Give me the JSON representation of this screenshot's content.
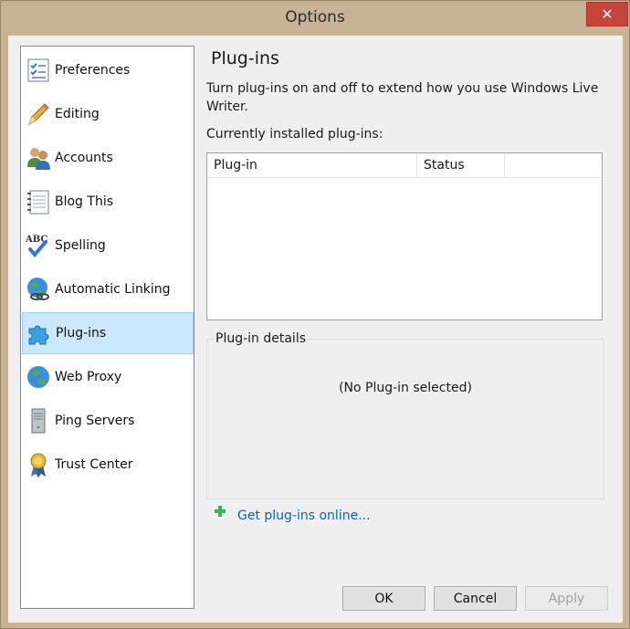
{
  "window": {
    "title": "Options",
    "close_glyph": "✕"
  },
  "sidebar": {
    "items": [
      {
        "label": "Preferences",
        "icon": "checklist-icon",
        "selected": false
      },
      {
        "label": "Editing",
        "icon": "pencil-icon",
        "selected": false
      },
      {
        "label": "Accounts",
        "icon": "users-icon",
        "selected": false
      },
      {
        "label": "Blog This",
        "icon": "notepad-icon",
        "selected": false
      },
      {
        "label": "Spelling",
        "icon": "abc-check-icon",
        "selected": false
      },
      {
        "label": "Automatic Linking",
        "icon": "globe-link-icon",
        "selected": false
      },
      {
        "label": "Plug-ins",
        "icon": "puzzle-icon",
        "selected": true
      },
      {
        "label": "Web Proxy",
        "icon": "globe-icon",
        "selected": false
      },
      {
        "label": "Ping Servers",
        "icon": "server-icon",
        "selected": false
      },
      {
        "label": "Trust Center",
        "icon": "ribbon-award-icon",
        "selected": false
      }
    ]
  },
  "main": {
    "heading": "Plug-ins",
    "description": "Turn plug-ins on and off to extend how you use Windows Live Writer.",
    "installed_label": "Currently installed plug-ins:",
    "columns": [
      "Plug-in",
      "Status"
    ],
    "rows": [],
    "details_legend": "Plug-in details",
    "no_selection": "(No Plug-in selected)",
    "get_online_link": "Get plug-ins online..."
  },
  "buttons": {
    "ok": "OK",
    "cancel": "Cancel",
    "apply": "Apply"
  },
  "colors": {
    "selection": "#cce8ff",
    "link": "#0b63b6",
    "frame": "#c9b396",
    "close": "#c7443a",
    "plus": "#3ab15a"
  }
}
